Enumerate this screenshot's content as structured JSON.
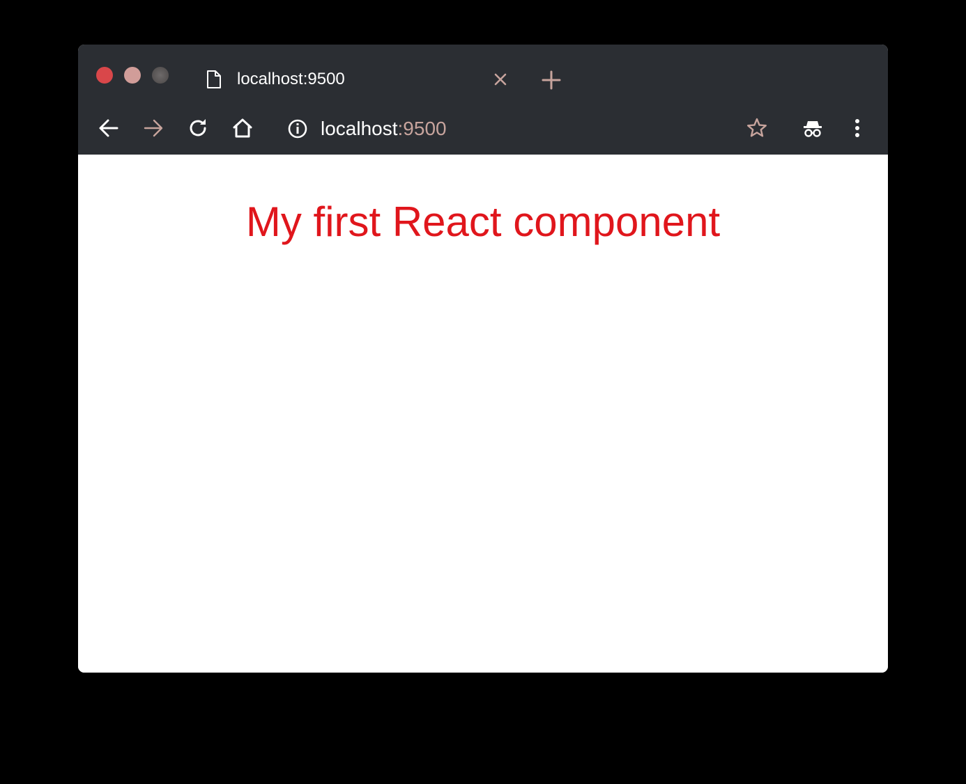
{
  "window": {
    "tab": {
      "title": "localhost:9500",
      "icon": "page-icon",
      "close_icon": "close-icon"
    },
    "new_tab_icon": "plus-icon",
    "toolbar": {
      "back_icon": "arrow-left-icon",
      "forward_icon": "arrow-right-icon",
      "reload_icon": "reload-icon",
      "home_icon": "home-icon",
      "info_icon": "info-icon",
      "url_host": "localhost",
      "url_port": ":9500",
      "star_icon": "star-icon",
      "incognito_icon": "incognito-icon",
      "menu_icon": "kebab-menu-icon"
    },
    "colors": {
      "chrome": "#2b2e33",
      "traffic_close": "#d9474a",
      "traffic_minimize": "#d19d99",
      "accent_muted": "#c7a49d"
    }
  },
  "page": {
    "heading": "My first React component",
    "heading_color": "#e0161c"
  }
}
